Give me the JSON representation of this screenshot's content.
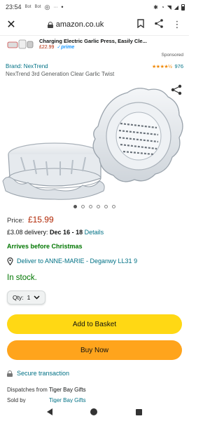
{
  "status": {
    "time": "23:54",
    "mini_icons": [
      "Bot",
      "Bot"
    ]
  },
  "browser": {
    "url": "amazon.co.uk"
  },
  "ad": {
    "title": "Charging Electric Garlic Press, Easily Cle...",
    "price": "£22.99",
    "prime": "✓prime",
    "sponsored": "Sponsored"
  },
  "product": {
    "brand": "Brand: NexTrend",
    "stars": "★★★★½",
    "rating_count": "976",
    "title": "NexTrend 3rd Generation Clear Garlic Twist",
    "image_count": 6,
    "image_active": 0
  },
  "price": {
    "label": "Price:",
    "amount": "£15.99"
  },
  "delivery": {
    "prefix": "£3.08 delivery: ",
    "dates": "Dec 16 - 18",
    "details": "Details"
  },
  "christmas": "Arrives before Christmas",
  "deliver_to": "Deliver to ANNE-MARIE - Deganwy LL31 9",
  "stock": "In stock.",
  "qty": {
    "label": "Qty:",
    "value": "1"
  },
  "buttons": {
    "basket": "Add to Basket",
    "buy": "Buy Now"
  },
  "secure": "Secure transaction",
  "info": {
    "dispatches_label": "Dispatches from",
    "dispatches_value": "Tiger Bay Gifts",
    "sold_label": "Sold by",
    "sold_value": "Tiger Bay Gifts"
  },
  "colors": {
    "link": "#007185",
    "price": "#b12704",
    "stock": "#007600",
    "basket": "#ffd814",
    "buy": "#ffa41c"
  }
}
